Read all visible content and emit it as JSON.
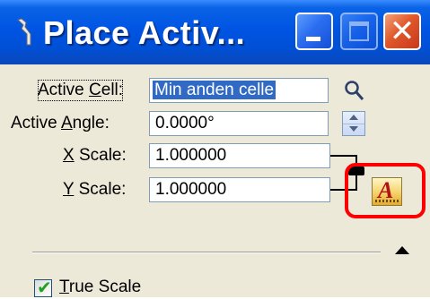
{
  "window": {
    "title": "Place Activ...",
    "title_icon": "wrench-icon",
    "buttons": {
      "minimize": "minimize-icon",
      "maximize": "maximize-icon",
      "close": "close-icon"
    }
  },
  "form": {
    "active_cell": {
      "label_pre": "Active ",
      "label_u": "C",
      "label_post": "ell:",
      "value": "Min anden celle"
    },
    "active_angle": {
      "label_pre": "Active ",
      "label_u": "A",
      "label_post": "ngle:",
      "value": "0.0000°"
    },
    "x_scale": {
      "label_u": "X",
      "label_post": " Scale:",
      "value": "1.000000"
    },
    "y_scale": {
      "label_u": "Y",
      "label_post": " Scale:",
      "value": "1.000000"
    }
  },
  "true_scale": {
    "label_u": "T",
    "label_post": "rue Scale",
    "checked": true
  },
  "colors": {
    "accent": "#0054e3",
    "highlight": "#ff0000",
    "selection": "#316ac5"
  }
}
